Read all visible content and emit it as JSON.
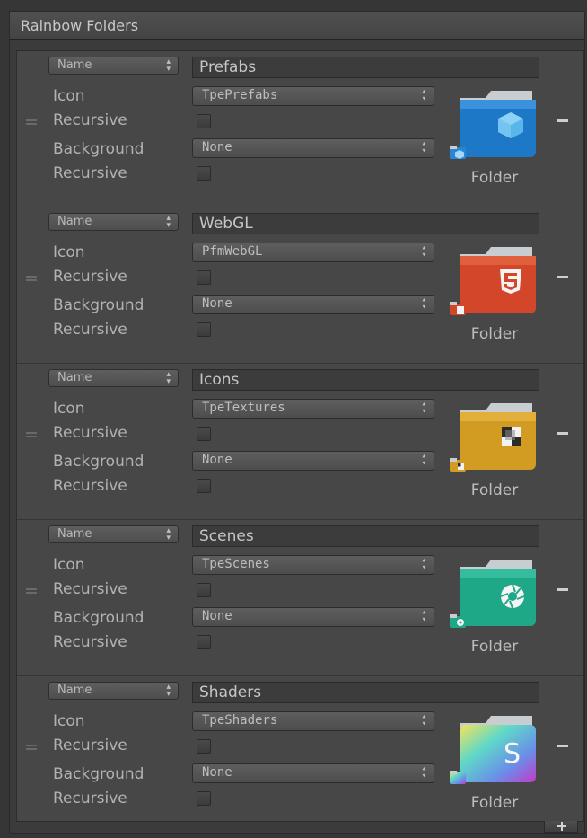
{
  "window": {
    "title": "Rainbow Folders"
  },
  "labels": {
    "icon": "Icon",
    "recursive": "Recursive",
    "background": "Background",
    "folder_caption": "Folder"
  },
  "rows": [
    {
      "name_mode": "Name",
      "name": "Prefabs",
      "icon": "TpePrefabs",
      "background": "None",
      "icon_recursive": false,
      "background_recursive": false,
      "folder_color": "#1e78c8",
      "folder_glyph": "cube-icon"
    },
    {
      "name_mode": "Name",
      "name": "WebGL",
      "icon": "PfmWebGL",
      "background": "None",
      "icon_recursive": false,
      "background_recursive": false,
      "folder_color": "#d4462a",
      "folder_glyph": "html5-icon"
    },
    {
      "name_mode": "Name",
      "name": "Icons",
      "icon": "TpeTextures",
      "background": "None",
      "icon_recursive": false,
      "background_recursive": false,
      "folder_color": "#d29c22",
      "folder_glyph": "checker-icon"
    },
    {
      "name_mode": "Name",
      "name": "Scenes",
      "icon": "TpeScenes",
      "background": "None",
      "icon_recursive": false,
      "background_recursive": false,
      "folder_color": "#1fa888",
      "folder_glyph": "shutter-icon"
    },
    {
      "name_mode": "Name",
      "name": "Shaders",
      "icon": "TpeShaders",
      "background": "None",
      "icon_recursive": false,
      "background_recursive": false,
      "folder_color": "#7a5cc8",
      "folder_glyph": "shader-s-icon"
    }
  ]
}
